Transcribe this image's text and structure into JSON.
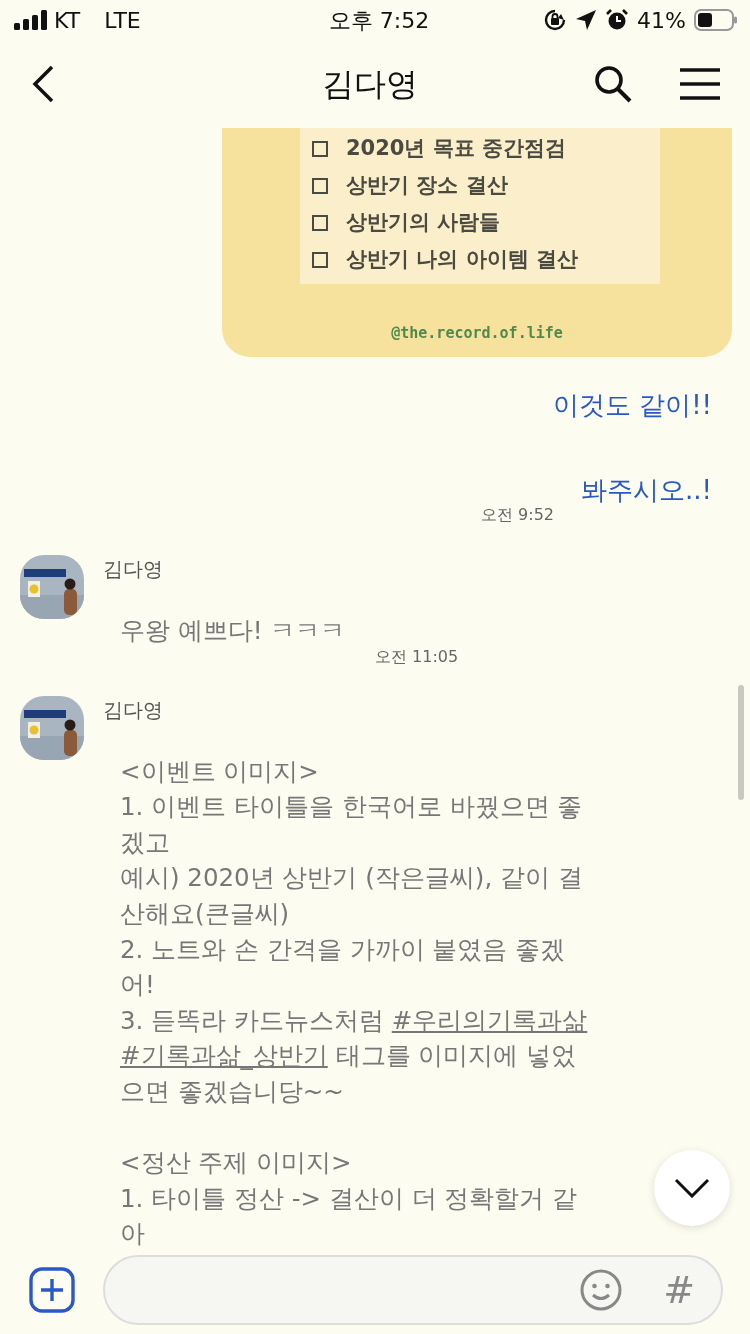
{
  "status_bar": {
    "carrier": "KT",
    "network": "LTE",
    "time": "오후 7:52",
    "battery": "41%"
  },
  "header": {
    "title": "김다영"
  },
  "shared_image": {
    "checklist": [
      {
        "text": "2020년 목표 중간점검"
      },
      {
        "text": "상반기 장소 결산"
      },
      {
        "text": "상반기의 사람들"
      },
      {
        "text": "상반기 나의 아이템 결산"
      }
    ],
    "handle": "@the.record.of.life"
  },
  "sent_messages": [
    {
      "text": "이것도 같이!!"
    },
    {
      "text": "봐주시오..!",
      "time": "오전 9:52"
    }
  ],
  "received_messages": [
    {
      "sender": "김다영",
      "time": "오전 11:05",
      "blocks": [
        [
          [
            {
              "text": "우왕 예쁘다!  ㅋㅋㅋ",
              "kind": "plain"
            }
          ]
        ]
      ]
    },
    {
      "sender": "김다영",
      "blocks": [
        [
          [
            {
              "text": "<이벤트 이미지>",
              "kind": "plain"
            }
          ],
          [
            {
              "text": "1. 이벤트 타이틀을 한국어로 바꿨으면 좋",
              "kind": "plain"
            }
          ],
          [
            {
              "text": "겠고",
              "kind": "plain"
            }
          ],
          [
            {
              "text": "예시) 2020년 상반기 (작은글씨), 같이 결",
              "kind": "plain"
            }
          ],
          [
            {
              "text": "산해요(큰글씨)",
              "kind": "plain"
            }
          ],
          [
            {
              "text": "2. 노트와 손 간격을 가까이 붙였음 좋겠",
              "kind": "plain"
            }
          ],
          [
            {
              "text": "어!",
              "kind": "plain"
            }
          ],
          [
            {
              "text": "3. 듣똑라 카드뉴스처럼 ",
              "kind": "plain"
            },
            {
              "text": "#우리의기록과삶",
              "kind": "hashtag"
            }
          ],
          [
            {
              "text": "#기록과삶_상반기",
              "kind": "hashtag"
            },
            {
              "text": " 태그를 이미지에 넣었",
              "kind": "plain"
            }
          ],
          [
            {
              "text": "으면 좋겠습니당~~",
              "kind": "plain"
            }
          ]
        ],
        [
          [
            {
              "text": "<정산 주제 이미지>",
              "kind": "plain"
            }
          ],
          [
            {
              "text": "1. 타이틀 정산 -> 결산이 더 정확할거 같",
              "kind": "plain"
            }
          ],
          [
            {
              "text": "아",
              "kind": "plain"
            }
          ]
        ]
      ]
    }
  ],
  "composer": {
    "hash_key": "#"
  }
}
